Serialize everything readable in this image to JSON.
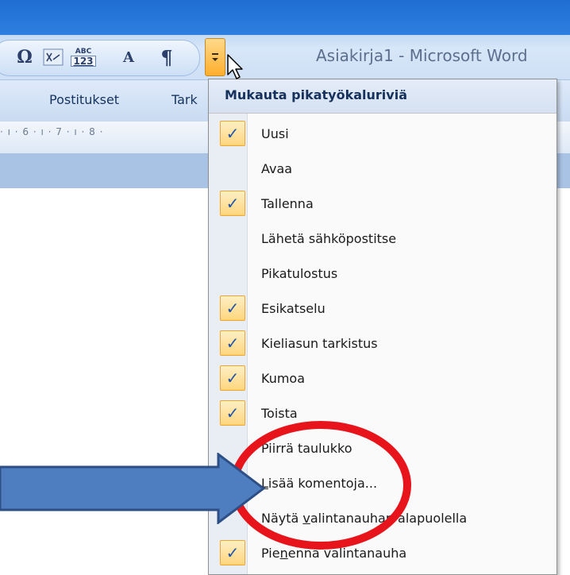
{
  "window": {
    "title": "Asiakirja1 - Microsoft Word"
  },
  "quick_access_toolbar": {
    "icons": [
      "omega-symbol-icon",
      "equation-icon",
      "spelling-abc-123-icon",
      "font-size-icon",
      "paragraph-mark-icon"
    ],
    "symbol_glyph": "Ω",
    "spelling_top": "ABC",
    "spelling_bottom": "123",
    "font_glyph": "A",
    "paragraph_glyph": "¶"
  },
  "ribbon": {
    "tabs": [
      "Postitukset",
      "Tark"
    ]
  },
  "ruler": {
    "marks": "· ı · 6 · ı · 7 · ı · 8 ·"
  },
  "menu": {
    "header": "Mukauta pikatyökaluriviä",
    "items": [
      {
        "label": "Uusi",
        "checked": true
      },
      {
        "label": "Avaa",
        "checked": false
      },
      {
        "label": "Tallenna",
        "checked": true
      },
      {
        "label": "Lähetä sähköpostitse",
        "checked": false
      },
      {
        "label": "Pikatulostus",
        "checked": false
      },
      {
        "label": "Esikatselu",
        "checked": true
      },
      {
        "label": "Kieliasun tarkistus",
        "checked": true
      },
      {
        "label": "Kumoa",
        "checked": true
      },
      {
        "label": "Toista",
        "checked": true
      },
      {
        "label": "Piirrä taulukko",
        "checked": false
      },
      {
        "label_pre": "",
        "label_ul": "L",
        "label_post": "isää komentoja...",
        "checked": false
      },
      {
        "label_pre": "Näytä ",
        "label_ul": "v",
        "label_post": "alintanauhan alapuolella",
        "checked": false
      },
      {
        "label_pre": "Pie",
        "label_ul": "n",
        "label_post": "ennä valintanauha",
        "checked": true
      }
    ],
    "check_glyph": "✓"
  },
  "colors": {
    "highlight_ellipse": "#e8141c",
    "arrow_fill": "#4f7ec0",
    "arrow_stroke": "#2d4f86",
    "check": "#2255a5",
    "check_bg": "#ffd67d"
  }
}
